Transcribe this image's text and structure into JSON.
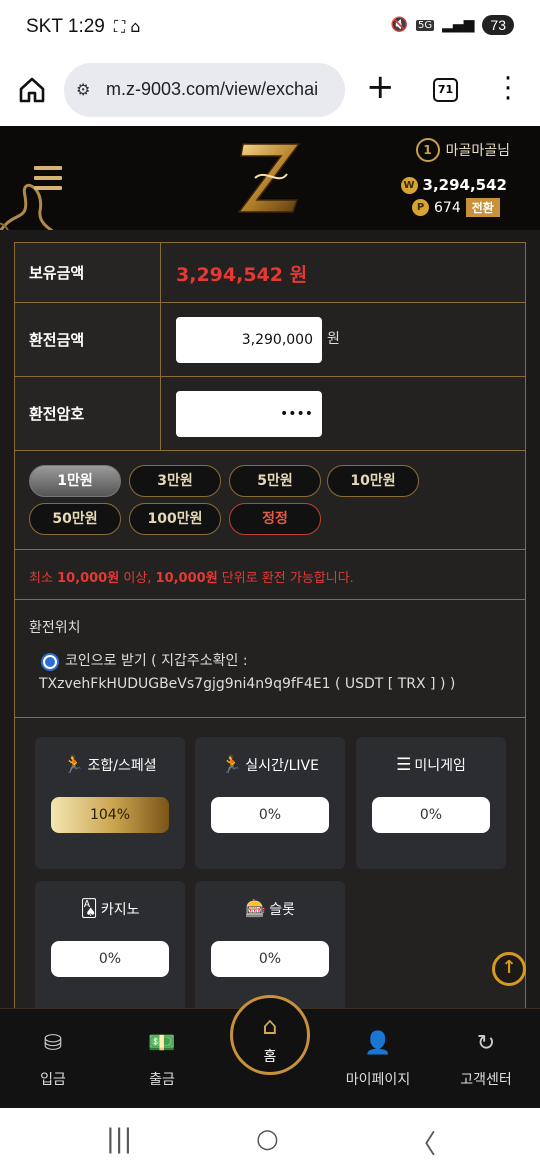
{
  "status_bar": {
    "carrier_time": "SKT 1:29",
    "network": "5G",
    "battery": "73"
  },
  "browser": {
    "url": "m.z-9003.com/view/exchai",
    "tab_count": "71"
  },
  "header": {
    "username": "마골마골님",
    "rank": "1",
    "money": "3,294,542",
    "money_icon": "W",
    "points": "674",
    "points_icon": "P",
    "convert_label": "전환"
  },
  "form": {
    "balance_label": "보유금액",
    "balance_value": "3,294,542 원",
    "amount_label": "환전금액",
    "amount_value": "3,290,000",
    "amount_unit": "원",
    "password_label": "환전암호",
    "password_value": "••••"
  },
  "chips": [
    "1만원",
    "3만원",
    "5만원",
    "10만원",
    "50만원",
    "100만원"
  ],
  "reset_label": "정정",
  "notice": {
    "prefix": "최소 ",
    "min": "10,000원",
    "mid": " 이상, ",
    "unit": "10,000원",
    "suffix": " 단위로 환전 가능합니다."
  },
  "location": {
    "title": "환전위치",
    "option_line1": "코인으로 받기 ( 지갑주소확인 :",
    "option_line2": "TXzvehFkHUDUGBeVs7gjg9ni4n9q9fF4E1 ( USDT [ TRX ] ) )"
  },
  "games": [
    {
      "title": "조합/스페셜",
      "icon": "running-icon",
      "rate": "104%",
      "highlight": true
    },
    {
      "title": "실시간/LIVE",
      "icon": "running-icon",
      "rate": "0%",
      "highlight": false
    },
    {
      "title": "미니게임",
      "icon": "ladder-icon",
      "rate": "0%",
      "highlight": false
    },
    {
      "title": "카지노",
      "icon": "cards-icon",
      "rate": "0%",
      "highlight": false
    },
    {
      "title": "슬롯",
      "icon": "slot-icon",
      "rate": "0%",
      "highlight": false
    }
  ],
  "bottom_nav": {
    "deposit": "입금",
    "withdraw": "출금",
    "home": "홈",
    "mypage": "마이페이지",
    "support": "고객센터"
  },
  "colors": {
    "accent_gold": "#c8913a",
    "warning_red": "#e53935",
    "panel_border": "#8a6d36"
  }
}
